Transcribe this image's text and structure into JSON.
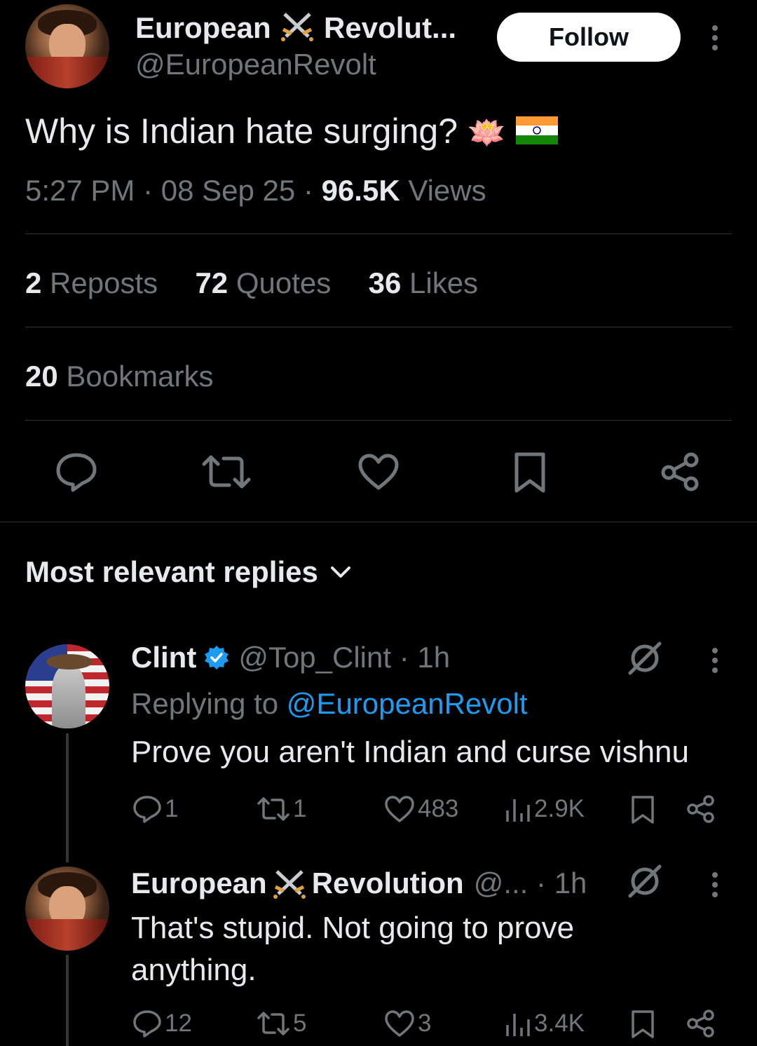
{
  "post": {
    "author_name_1": "European",
    "author_name_2": "Revolut...",
    "author_handle": "@EuropeanRevolt",
    "follow_label": "Follow",
    "text": "Why is Indian hate surging?",
    "emoji_1": "🪷",
    "emoji_2": "🇮🇳",
    "time": "5:27 PM",
    "date": "08 Sep 25",
    "views_count": "96.5K",
    "views_label": "Views",
    "reposts_count": "2",
    "reposts_label": "Reposts",
    "quotes_count": "72",
    "quotes_label": "Quotes",
    "likes_count": "36",
    "likes_label": "Likes",
    "bookmarks_count": "20",
    "bookmarks_label": "Bookmarks"
  },
  "replies_header": "Most relevant replies",
  "replies": [
    {
      "name": "Clint",
      "handle": "@Top_Clint",
      "time": "1h",
      "replying_prefix": "Replying to",
      "replying_handle": "@EuropeanRevolt",
      "text": "Prove you aren't Indian and curse vishnu",
      "reply_count": "1",
      "repost_count": "1",
      "like_count": "483",
      "view_count": "2.9K"
    },
    {
      "name_1": "European",
      "name_2": "Revolution",
      "handle": "@...",
      "time": "1h",
      "text_line_1": "That's stupid. Not going to prove",
      "text_line_2": "anything.",
      "reply_count": "12",
      "repost_count": "5",
      "like_count": "3",
      "view_count": "3.4K"
    }
  ],
  "colors": {
    "background": "#000000",
    "text": "#e7e9ea",
    "secondary": "#71767b",
    "link": "#1d9bf0",
    "divider": "#2f3336"
  },
  "icons": [
    "crossed-swords-icon",
    "reply-icon",
    "repost-icon",
    "like-icon",
    "bookmark-icon",
    "share-icon",
    "views-icon",
    "verified-badge-icon",
    "grok-icon",
    "more-icon",
    "chevron-down-icon"
  ]
}
